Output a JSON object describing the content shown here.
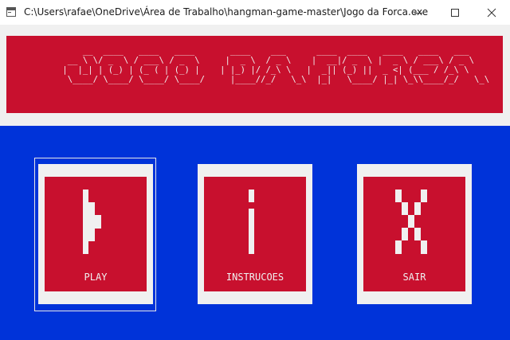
{
  "window": {
    "title": "C:\\Users\\rafae\\OneDrive\\Área de Trabalho\\hangman-game-master\\Jogo da Forca.exe",
    "icon": "console-app-icon",
    "controls": [
      "minimize-icon",
      "maximize-icon",
      "close-icon"
    ]
  },
  "banner": {
    "ascii_title": "     __  ____   ____   ____       ____    ___      ____  ____   ____   ____   ___\n  __ \\ \\/ _  \\ / ___\\ / _  \\     |  _ \\  / _ \\    |  __|/ _  \\ |  _ \\ / ___\\ / _ \\\n |  |_| | (_) | (_ ( | (_) |    | |_) |/ /_\\ \\   |  _|| (_) ||  _ <| (___ / /_\\ \\\n  \\____/ \\____/ \\____/ \\____/     |____//_/   \\_\\  |_|   \\____/ |_| \\_\\\\____/_/   \\_\\"
  },
  "menu": {
    "options": [
      {
        "label": "PLAY",
        "icon": "play-icon",
        "selected": true
      },
      {
        "label": "INSTRUCOES",
        "icon": "info-icon",
        "selected": false
      },
      {
        "label": "SAIR",
        "icon": "exit-x-icon",
        "selected": false
      }
    ]
  },
  "colors": {
    "banner_red": "#c8102e",
    "background_blue": "#0033d9",
    "card_frame": "#f0f0f0",
    "text": "#f0f0f0"
  }
}
